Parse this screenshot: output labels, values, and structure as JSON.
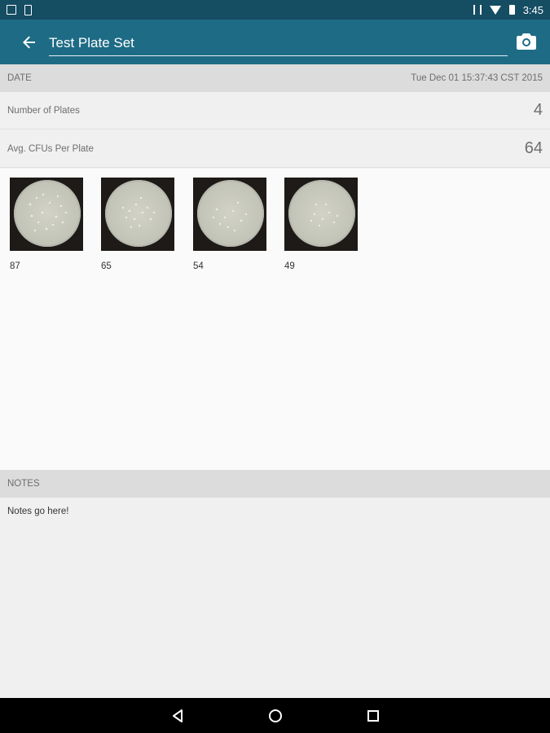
{
  "status_bar": {
    "time": "3:45"
  },
  "app_bar": {
    "title": "Test Plate Set"
  },
  "date_section": {
    "header": "DATE",
    "value": "Tue Dec 01 15:37:43 CST 2015"
  },
  "stats": [
    {
      "label": "Number of Plates",
      "value": "4"
    },
    {
      "label": "Avg. CFUs Per Plate",
      "value": "64"
    }
  ],
  "plates": [
    {
      "count": "87"
    },
    {
      "count": "65"
    },
    {
      "count": "54"
    },
    {
      "count": "49"
    }
  ],
  "notes_section": {
    "header": "NOTES",
    "text": "Notes go here!"
  },
  "colors": {
    "status_bar": "#154d63",
    "app_bar": "#1e6b85",
    "section_header": "#dcdcdc"
  }
}
